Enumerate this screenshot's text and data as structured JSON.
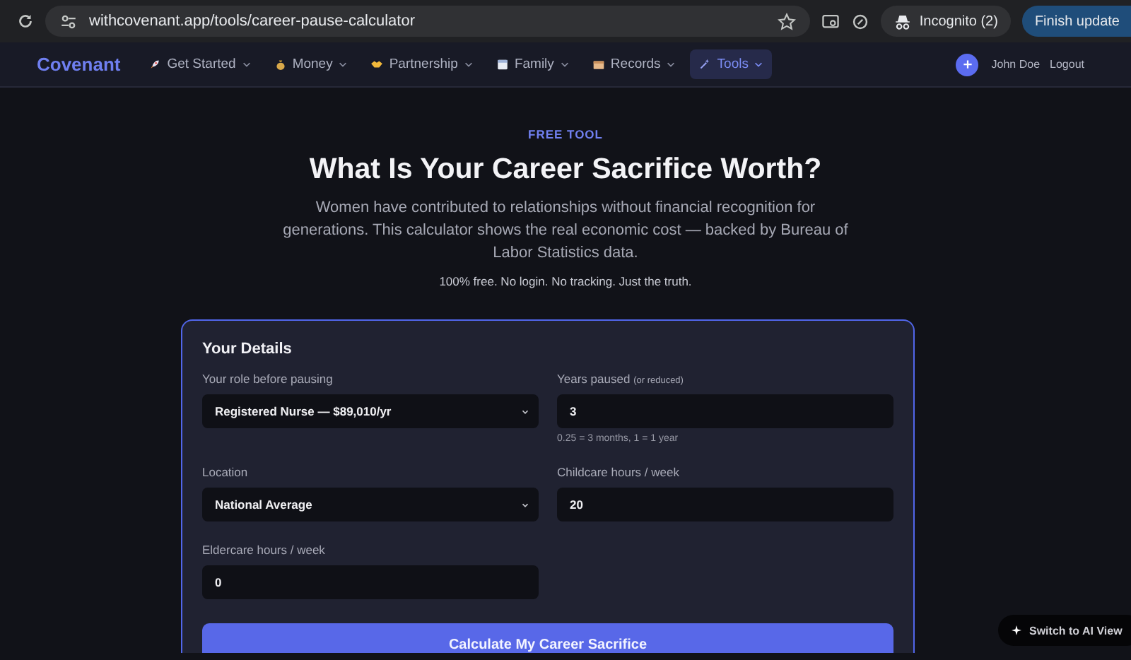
{
  "browser": {
    "url": "withcovenant.app/tools/career-pause-calculator",
    "incognito": "Incognito (2)",
    "update_button": "Finish update"
  },
  "nav": {
    "brand": "Covenant",
    "items": [
      {
        "label": "Get Started",
        "selected": false
      },
      {
        "label": "Money",
        "selected": false
      },
      {
        "label": "Partnership",
        "selected": false
      },
      {
        "label": "Family",
        "selected": false
      },
      {
        "label": "Records",
        "selected": false
      },
      {
        "label": "Tools",
        "selected": true
      }
    ],
    "user": "John Doe",
    "logout": "Logout"
  },
  "hero": {
    "eyebrow": "FREE TOOL",
    "title": "What Is Your Career Sacrifice Worth?",
    "subtitle": "Women have contributed to relationships without financial recognition for generations. This calculator shows the real economic cost — backed by Bureau of Labor Statistics data.",
    "note": "100% free. No login. No tracking. Just the truth."
  },
  "form": {
    "title": "Your Details",
    "fields": [
      {
        "kind": "select",
        "label": "Your role before pausing",
        "value": "Registered Nurse — $89,010/yr"
      },
      {
        "kind": "input",
        "label": "Years paused",
        "label_note": "(or reduced)",
        "value": "3",
        "hint": "0.25 = 3 months, 1 = 1 year"
      },
      {
        "kind": "select",
        "label": "Location",
        "value": "National Average"
      },
      {
        "kind": "input",
        "label": "Childcare hours / week",
        "value": "20"
      },
      {
        "kind": "input",
        "label": "Eldercare hours / week",
        "value": "0"
      }
    ],
    "submit": "Calculate My Career Sacrifice"
  },
  "floating_button": "Switch to AI View"
}
